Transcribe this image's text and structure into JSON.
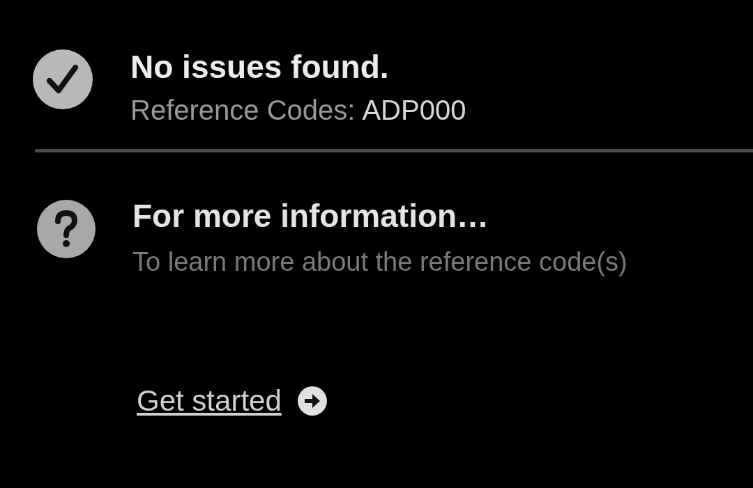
{
  "result": {
    "passed": true,
    "title": "No issues found.",
    "codes_label": "Reference Codes:",
    "codes": "ADP000"
  },
  "info": {
    "title": "For more information…",
    "text": "To learn more about the reference code(s)"
  },
  "link": {
    "label": "Get started"
  }
}
